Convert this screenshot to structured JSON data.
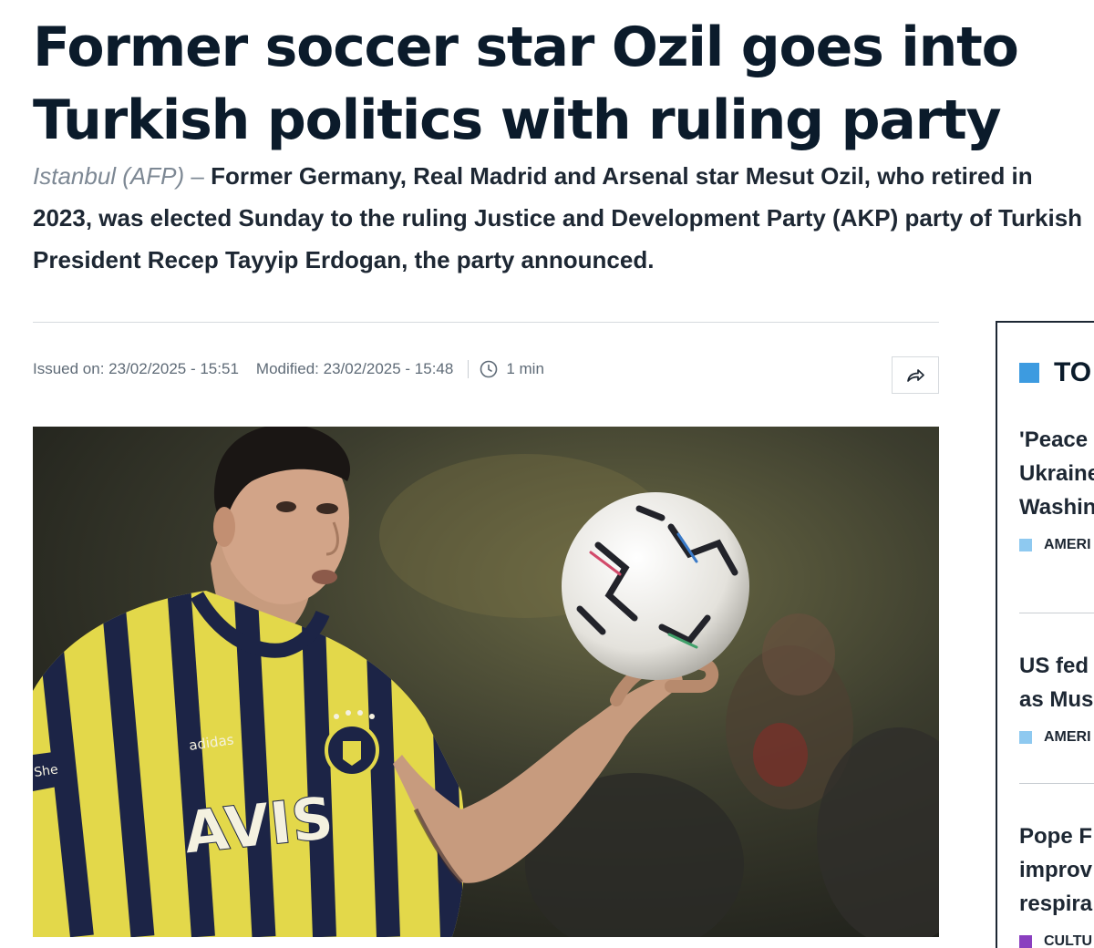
{
  "article": {
    "headline_line1": "Former soccer star Ozil goes into",
    "headline_line2": "Turkish politics with ruling party",
    "dateline": "Istanbul (AFP)",
    "dash": " – ",
    "lede": "Former Germany, Real Madrid and Arsenal star Mesut Ozil, who retired in 2023, was elected Sunday to the ruling Justice and Development Party (AKP) party of Turkish President Recep Tayyip Erdogan, the party announced.",
    "issued": "Issued on: 23/02/2025 - 15:51",
    "modified": "Modified: 23/02/2025 - 15:48",
    "read_time": "1 min",
    "share_icon": "share-arrow-icon",
    "photo_text": {
      "sponsor": "AVIS",
      "brand": "adidas",
      "sleeve": "She"
    }
  },
  "sidebar": {
    "heading": "TO",
    "accent": "#3d9be0",
    "items": [
      {
        "line1": "'Peace",
        "line2": "Ukraine",
        "line3": "Washin",
        "tag": "AMERI",
        "tag_color": "#8ec9f0"
      },
      {
        "line1": "US fed",
        "line2": "as Mus",
        "tag": "AMERI",
        "tag_color": "#8ec9f0"
      },
      {
        "line1": "Pope F",
        "line2": "improv",
        "line3": "respira",
        "tag": "CULTU",
        "tag_color": "#8a3fbf"
      }
    ]
  },
  "colors": {
    "headline": "#0b1b2b",
    "muted": "#7d8894",
    "jersey_yellow": "#e3d84a",
    "jersey_navy": "#1c2446"
  }
}
